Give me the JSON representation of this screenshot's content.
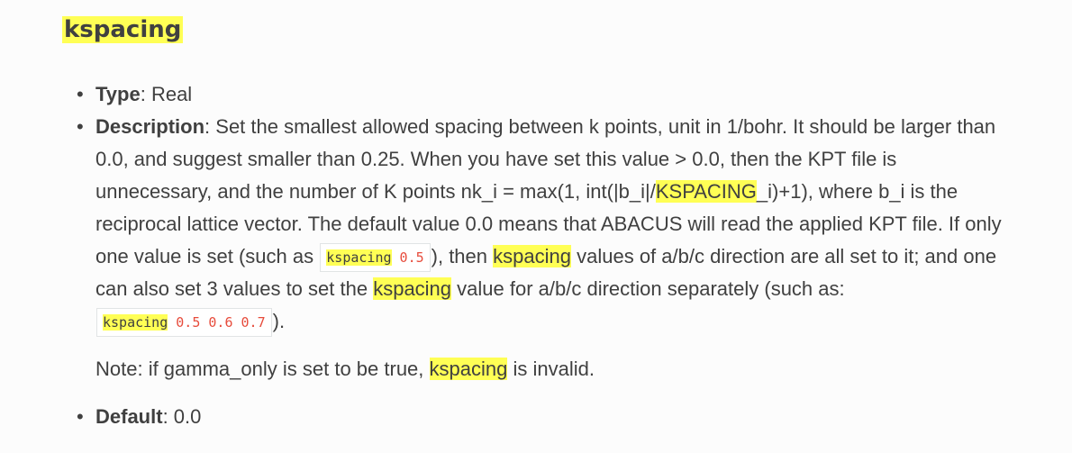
{
  "heading": "kspacing",
  "type_item": {
    "label": "Type",
    "sep": ": ",
    "value": "Real"
  },
  "description": {
    "label": "Description",
    "sep": ": ",
    "line1": "Set the smallest allowed spacing between k points, unit in 1/bohr. It should be",
    "line2": "larger than 0.0, and suggest smaller than 0.25. When you have set this value > 0.0, then the KPT",
    "line3_a": "file is unnecessary, and the number of K points nk_i = max(1, int(|b_i|/",
    "line3_hl": "KSPACING",
    "line3_b": "_i)+1), where",
    "line4": "b_i is the reciprocal lattice vector. The default value 0.0 means that ABACUS will read the",
    "line5_a": "applied KPT file. If only one value is set (such as",
    "code1_kw": "kspacing",
    "code1_num": "0.5",
    "line5_b": "), then",
    "line5_hl": "kspacing",
    "line5_c": "values of a/b/c",
    "line6_a": "direction are all set to it; and one can also set 3 values to set the",
    "line6_hl": "kspacing",
    "line6_b": "value for a/b/c",
    "line7_a": "direction separately (such as:",
    "code2_kw": "kspacing",
    "code2_num": "0.5 0.6 0.7",
    "line7_b": ").",
    "note_a": "Note: if gamma_only is set to be true,",
    "note_hl": "kspacing",
    "note_b": "is invalid."
  },
  "default_item": {
    "label": "Default",
    "sep": ": ",
    "value": "0.0"
  },
  "bullet_char": "•",
  "colors": {
    "highlight": "#ffff55",
    "text": "#404040",
    "code_number": "#e74c3c",
    "background": "#fcfcfc"
  }
}
